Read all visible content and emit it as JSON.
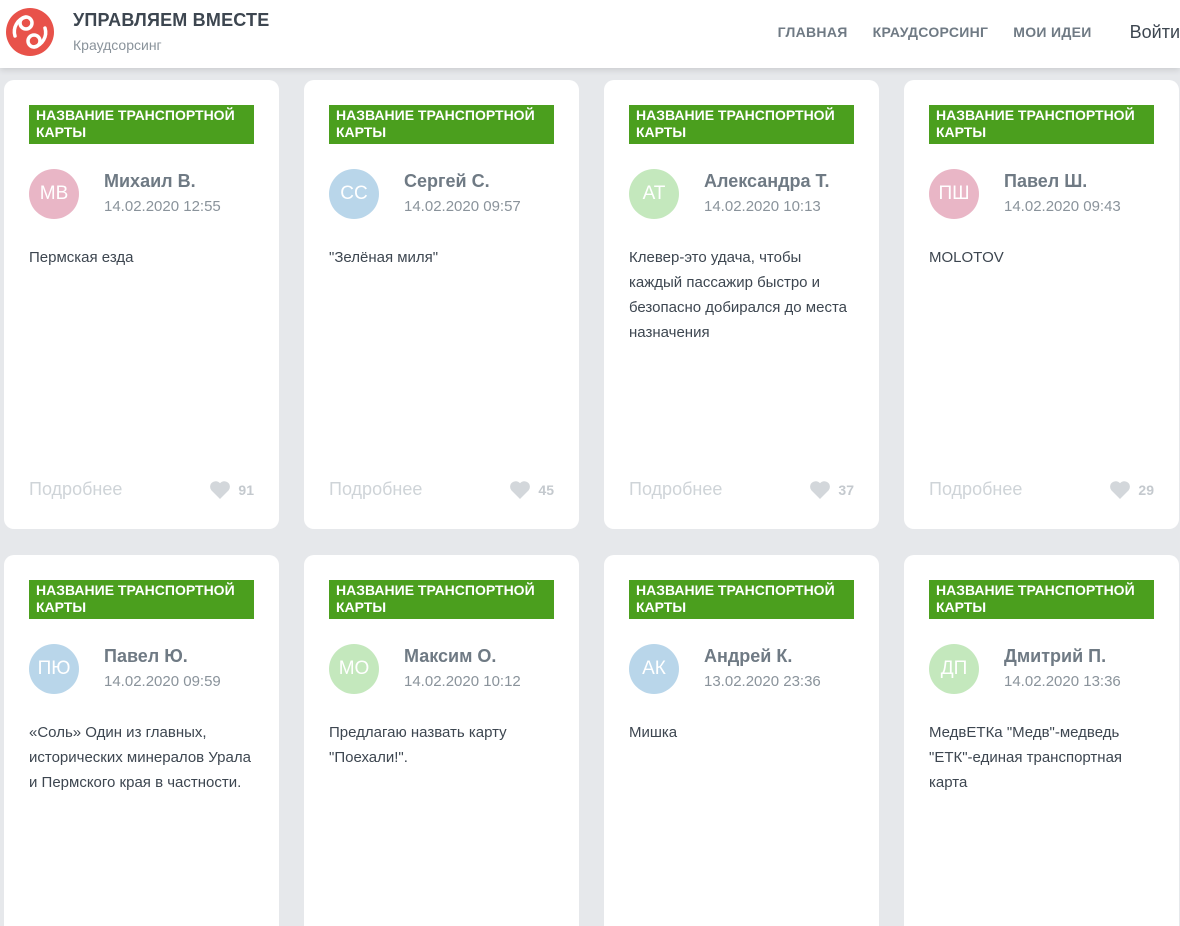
{
  "header": {
    "title": "УПРАВЛЯЕМ ВМЕСТЕ",
    "subtitle": "Краудсорсинг",
    "logo_color": "#e8524a",
    "nav": [
      "ГЛАВНАЯ",
      "КРАУДСОРСИНГ",
      "МОИ ИДЕИ"
    ],
    "login": "Войти"
  },
  "more_label": "Подробнее",
  "accent_color": "#4b9f1e",
  "cards": [
    {
      "tag": "НАЗВАНИЕ ТРАНСПОРТНОЙ КАРТЫ",
      "initials": "МВ",
      "avatar_color": "#e9b6c6",
      "author": "Михаил В.",
      "date": "14.02.2020 12:55",
      "text": "Пермская езда",
      "likes": "91"
    },
    {
      "tag": "НАЗВАНИЕ ТРАНСПОРТНОЙ КАРТЫ",
      "initials": "СС",
      "avatar_color": "#b9d6ea",
      "author": "Сергей С.",
      "date": "14.02.2020 09:57",
      "text": "\"Зелёная миля\"",
      "likes": "45"
    },
    {
      "tag": "НАЗВАНИЕ ТРАНСПОРТНОЙ КАРТЫ",
      "initials": "АТ",
      "avatar_color": "#c4e8bd",
      "author": "Александра Т.",
      "date": "14.02.2020 10:13",
      "text": "Клевер-это удача, чтобы каждый пассажир быстро и безопасно добирался до места назначения",
      "likes": "37"
    },
    {
      "tag": "НАЗВАНИЕ ТРАНСПОРТНОЙ КАРТЫ",
      "initials": "ПШ",
      "avatar_color": "#e9b6c6",
      "author": "Павел Ш.",
      "date": "14.02.2020 09:43",
      "text": "MOLOTOV",
      "likes": "29"
    },
    {
      "tag": "НАЗВАНИЕ ТРАНСПОРТНОЙ КАРТЫ",
      "initials": "ПЮ",
      "avatar_color": "#b9d6ea",
      "author": "Павел Ю.",
      "date": "14.02.2020 09:59",
      "text": "«Соль» Один из главных, исторических минералов Урала и Пермского края в частности.",
      "likes": ""
    },
    {
      "tag": "НАЗВАНИЕ ТРАНСПОРТНОЙ КАРТЫ",
      "initials": "МО",
      "avatar_color": "#c4e8bd",
      "author": "Максим О.",
      "date": "14.02.2020 10:12",
      "text": "Предлагаю назвать карту \"Поехали!\".",
      "likes": ""
    },
    {
      "tag": "НАЗВАНИЕ ТРАНСПОРТНОЙ КАРТЫ",
      "initials": "АК",
      "avatar_color": "#b9d6ea",
      "author": "Андрей К.",
      "date": "13.02.2020 23:36",
      "text": "Мишка",
      "likes": ""
    },
    {
      "tag": "НАЗВАНИЕ ТРАНСПОРТНОЙ КАРТЫ",
      "initials": "ДП",
      "avatar_color": "#c4e8bd",
      "author": "Дмитрий П.",
      "date": "14.02.2020 13:36",
      "text": "МедвЕТКа \"Медв\"-медведь \"ЕТК\"-единая транспортная карта",
      "likes": ""
    }
  ]
}
